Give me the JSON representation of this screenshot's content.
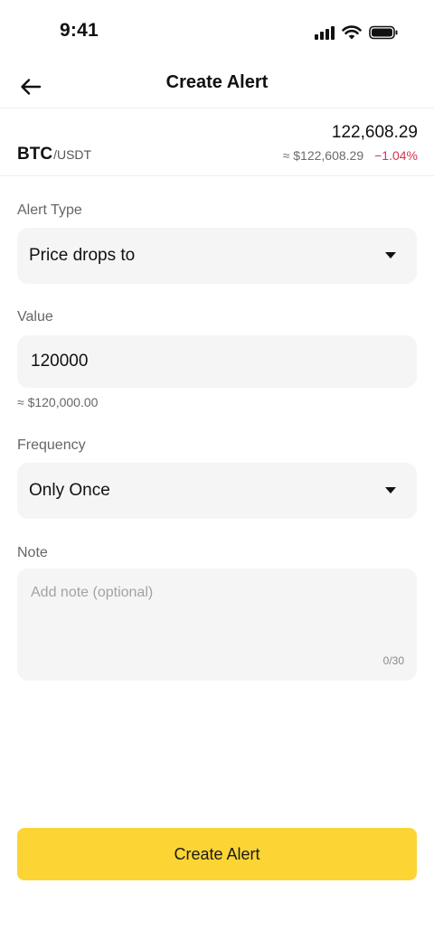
{
  "status_bar": {
    "time": "9:41"
  },
  "header": {
    "title": "Create Alert",
    "back_icon": "arrow-left-icon"
  },
  "ticker": {
    "base": "BTC",
    "quote": "/USDT",
    "price": "122,608.29",
    "price_usd": "≈ $122,608.29",
    "change": "−1.04%"
  },
  "form": {
    "alert_type": {
      "label": "Alert Type",
      "value": "Price drops to"
    },
    "value": {
      "label": "Value",
      "input": "120000",
      "usd_equivalent": "≈ $120,000.00"
    },
    "frequency": {
      "label": "Frequency",
      "value": "Only Once"
    },
    "note": {
      "label": "Note",
      "placeholder": "Add note (optional)",
      "counter": "0/30"
    }
  },
  "submit": {
    "label": "Create Alert"
  },
  "colors": {
    "accent": "#fcd535",
    "negative": "#d9304f",
    "field_bg": "#f5f5f5"
  }
}
